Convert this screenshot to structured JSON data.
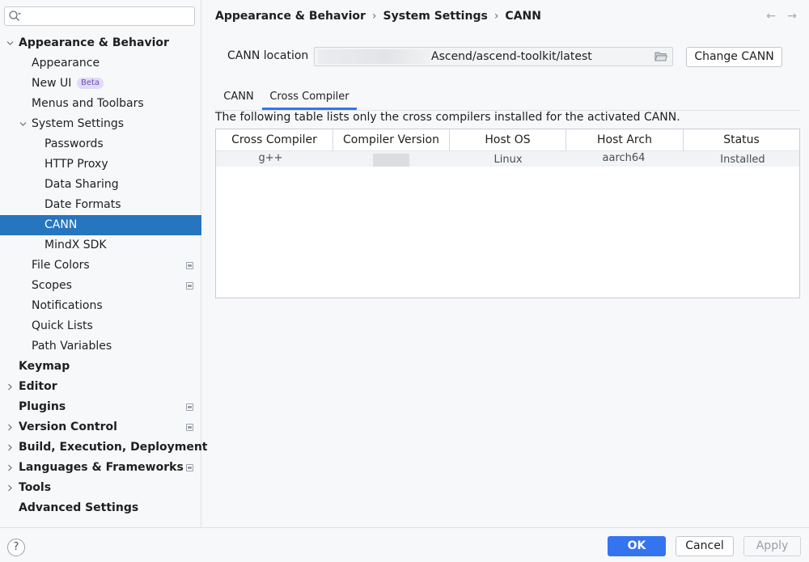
{
  "search": {
    "placeholder": ""
  },
  "tree": [
    {
      "label": "Appearance & Behavior",
      "level": 0,
      "bold": true,
      "arrow": "down"
    },
    {
      "label": "Appearance",
      "level": 1
    },
    {
      "label": "New UI",
      "level": 1,
      "badge": "Beta"
    },
    {
      "label": "Menus and Toolbars",
      "level": 1
    },
    {
      "label": "System Settings",
      "level": 1,
      "arrow": "down"
    },
    {
      "label": "Passwords",
      "level": 2
    },
    {
      "label": "HTTP Proxy",
      "level": 2
    },
    {
      "label": "Data Sharing",
      "level": 2
    },
    {
      "label": "Date Formats",
      "level": 2
    },
    {
      "label": "CANN",
      "level": 2,
      "selected": true
    },
    {
      "label": "MindX SDK",
      "level": 2
    },
    {
      "label": "File Colors",
      "level": 1,
      "project_icon": true
    },
    {
      "label": "Scopes",
      "level": 1,
      "project_icon": true
    },
    {
      "label": "Notifications",
      "level": 1
    },
    {
      "label": "Quick Lists",
      "level": 1
    },
    {
      "label": "Path Variables",
      "level": 1
    },
    {
      "label": "Keymap",
      "level": 0,
      "bold": true
    },
    {
      "label": "Editor",
      "level": 0,
      "bold": true,
      "arrow": "right"
    },
    {
      "label": "Plugins",
      "level": 0,
      "bold": true,
      "project_icon": true
    },
    {
      "label": "Version Control",
      "level": 0,
      "bold": true,
      "arrow": "right",
      "project_icon": true
    },
    {
      "label": "Build, Execution, Deployment",
      "level": 0,
      "bold": true,
      "arrow": "right"
    },
    {
      "label": "Languages & Frameworks",
      "level": 0,
      "bold": true,
      "arrow": "right",
      "project_icon": true
    },
    {
      "label": "Tools",
      "level": 0,
      "bold": true,
      "arrow": "right"
    },
    {
      "label": "Advanced Settings",
      "level": 0,
      "bold": true
    }
  ],
  "breadcrumb": [
    "Appearance & Behavior",
    "System Settings",
    "CANN"
  ],
  "breadcrumb_sep": "›",
  "nav": {
    "back": "←",
    "forward": "→"
  },
  "location": {
    "label": "CANN location",
    "prefix": "/",
    "value": "Ascend/ascend-toolkit/latest",
    "button": "Change CANN"
  },
  "tabs": [
    {
      "label": "CANN",
      "active": false
    },
    {
      "label": "Cross Compiler",
      "active": true
    }
  ],
  "description": "The following table lists only the cross compilers installed for the activated CANN.",
  "table": {
    "columns": [
      "Cross Compiler",
      "Compiler Version",
      "Host OS",
      "Host Arch",
      "Status"
    ],
    "rows": [
      {
        "compiler": "g++",
        "version": "",
        "os": "Linux",
        "arch": "aarch64",
        "status": "Installed"
      }
    ]
  },
  "footer": {
    "help": "?",
    "ok": "OK",
    "cancel": "Cancel",
    "apply": "Apply"
  },
  "colors": {
    "accent": "#3574f0",
    "selection": "#2675bf"
  }
}
